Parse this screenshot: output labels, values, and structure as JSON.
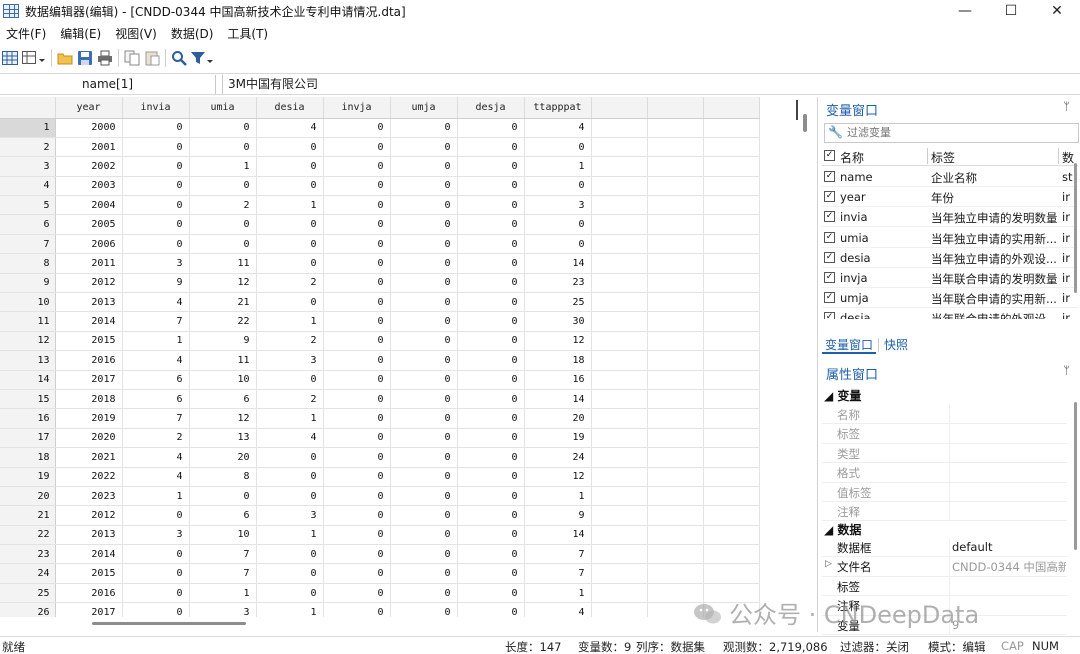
{
  "window": {
    "title": "数据编辑器(编辑) - [CNDD-0344 中国高新技术企业专利申请情况.dta]",
    "minimize_glyph": "—",
    "maximize_glyph": "☐",
    "close_glyph": "✕"
  },
  "menu": [
    "文件(F)",
    "编辑(E)",
    "视图(V)",
    "数据(D)",
    "工具(T)"
  ],
  "toolbar_icons": [
    "data-editor-icon",
    "browse-mode-icon",
    "open-folder-icon",
    "save-icon",
    "print-icon",
    "copy-icon",
    "paste-icon",
    "find-icon",
    "filter-icon"
  ],
  "cell_editor": {
    "variable": "name[1]",
    "value": "3M中国有限公司"
  },
  "grid": {
    "columns": [
      "year",
      "invia",
      "umia",
      "desia",
      "invja",
      "umja",
      "desja",
      "ttapppat"
    ],
    "rows": [
      [
        1,
        2000,
        0,
        0,
        4,
        0,
        0,
        0,
        4
      ],
      [
        2,
        2001,
        0,
        0,
        0,
        0,
        0,
        0,
        0
      ],
      [
        3,
        2002,
        0,
        1,
        0,
        0,
        0,
        0,
        1
      ],
      [
        4,
        2003,
        0,
        0,
        0,
        0,
        0,
        0,
        0
      ],
      [
        5,
        2004,
        0,
        2,
        1,
        0,
        0,
        0,
        3
      ],
      [
        6,
        2005,
        0,
        0,
        0,
        0,
        0,
        0,
        0
      ],
      [
        7,
        2006,
        0,
        0,
        0,
        0,
        0,
        0,
        0
      ],
      [
        8,
        2011,
        3,
        11,
        0,
        0,
        0,
        0,
        14
      ],
      [
        9,
        2012,
        9,
        12,
        2,
        0,
        0,
        0,
        23
      ],
      [
        10,
        2013,
        4,
        21,
        0,
        0,
        0,
        0,
        25
      ],
      [
        11,
        2014,
        7,
        22,
        1,
        0,
        0,
        0,
        30
      ],
      [
        12,
        2015,
        1,
        9,
        2,
        0,
        0,
        0,
        12
      ],
      [
        13,
        2016,
        4,
        11,
        3,
        0,
        0,
        0,
        18
      ],
      [
        14,
        2017,
        6,
        10,
        0,
        0,
        0,
        0,
        16
      ],
      [
        15,
        2018,
        6,
        6,
        2,
        0,
        0,
        0,
        14
      ],
      [
        16,
        2019,
        7,
        12,
        1,
        0,
        0,
        0,
        20
      ],
      [
        17,
        2020,
        2,
        13,
        4,
        0,
        0,
        0,
        19
      ],
      [
        18,
        2021,
        4,
        20,
        0,
        0,
        0,
        0,
        24
      ],
      [
        19,
        2022,
        4,
        8,
        0,
        0,
        0,
        0,
        12
      ],
      [
        20,
        2023,
        1,
        0,
        0,
        0,
        0,
        0,
        1
      ],
      [
        21,
        2012,
        0,
        6,
        3,
        0,
        0,
        0,
        9
      ],
      [
        22,
        2013,
        3,
        10,
        1,
        0,
        0,
        0,
        14
      ],
      [
        23,
        2014,
        0,
        7,
        0,
        0,
        0,
        0,
        7
      ],
      [
        24,
        2015,
        0,
        7,
        0,
        0,
        0,
        0,
        7
      ],
      [
        25,
        2016,
        0,
        1,
        0,
        0,
        0,
        0,
        1
      ],
      [
        26,
        2017,
        0,
        3,
        1,
        0,
        0,
        0,
        4
      ]
    ]
  },
  "variables_window": {
    "title": "变量窗口",
    "pin_glyph": "ᛘ",
    "filter_placeholder": "过滤变量",
    "headers": {
      "name": "名称",
      "label": "标签",
      "type": "数"
    },
    "vars": [
      {
        "name": "name",
        "label": "企业名称",
        "type": "st"
      },
      {
        "name": "year",
        "label": "年份",
        "type": "ir"
      },
      {
        "name": "invia",
        "label": "当年独立申请的发明数量",
        "type": "ir"
      },
      {
        "name": "umia",
        "label": "当年独立申请的实用新...",
        "type": "ir"
      },
      {
        "name": "desia",
        "label": "当年独立申请的外观设...",
        "type": "ir"
      },
      {
        "name": "invja",
        "label": "当年联合申请的发明数量",
        "type": "ir"
      },
      {
        "name": "umja",
        "label": "当年联合申请的实用新...",
        "type": "ir"
      },
      {
        "name": "desja",
        "label": "当年联合申请的外观设...",
        "type": "ir"
      }
    ]
  },
  "panel_tabs": {
    "variables": "变量窗口",
    "snapshots": "快照"
  },
  "properties_window": {
    "title": "属性窗口",
    "var_section": "变量",
    "var_props": [
      "名称",
      "标签",
      "类型",
      "格式",
      "值标签",
      "注释"
    ],
    "data_section": "数据",
    "data_props": [
      {
        "key": "数据框",
        "value": "default"
      },
      {
        "key": "文件名",
        "value": "CNDD-0344 中国高新"
      },
      {
        "key": "标签",
        "value": ""
      },
      {
        "key": "注释",
        "value": ""
      },
      {
        "key": "变量",
        "value": "9"
      }
    ]
  },
  "watermark": "公众号 · CNDeepData",
  "status": {
    "ready": "就绪",
    "length": "长度：147",
    "var_count": "变量数：9",
    "order": "列序：数据集",
    "obs": "观测数：2,719,086",
    "filter": "过滤器：关闭",
    "mode": "模式：编辑",
    "cap": "CAP",
    "num": "NUM"
  }
}
